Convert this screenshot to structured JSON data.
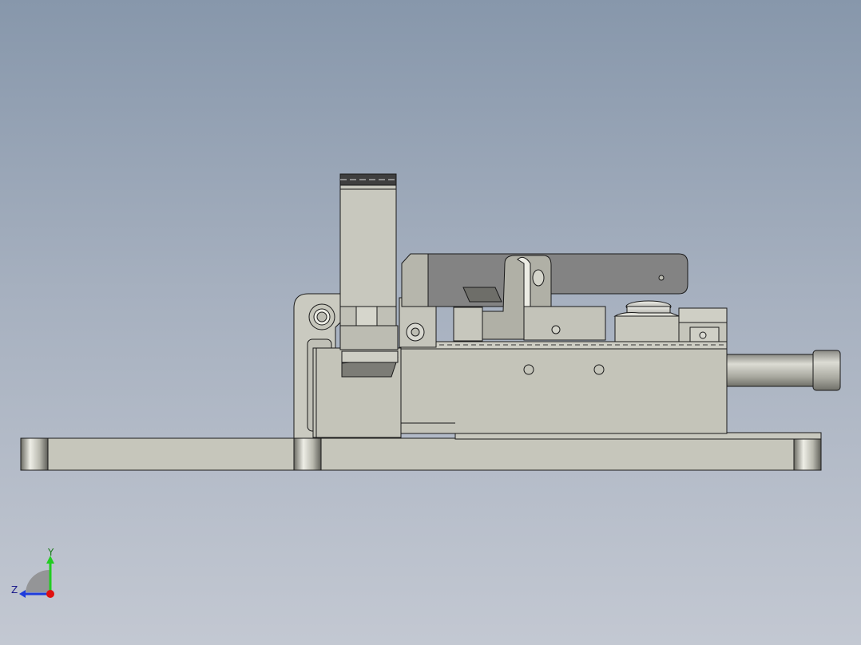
{
  "viewport": {
    "background_top": "#8797ab",
    "background_bottom": "#c3c8d2"
  },
  "model": {
    "metal_light": "#c9c9bf",
    "metal_mid": "#b4b4aa",
    "metal_dark": "#7b7b76",
    "edge": "#1a1a1a",
    "arm_color": "#828282"
  },
  "triad": {
    "y_label": "Y",
    "z_label": "Z",
    "y_color": "#22cc22",
    "z_color": "#1e3cdc",
    "x_color": "#e01010"
  }
}
